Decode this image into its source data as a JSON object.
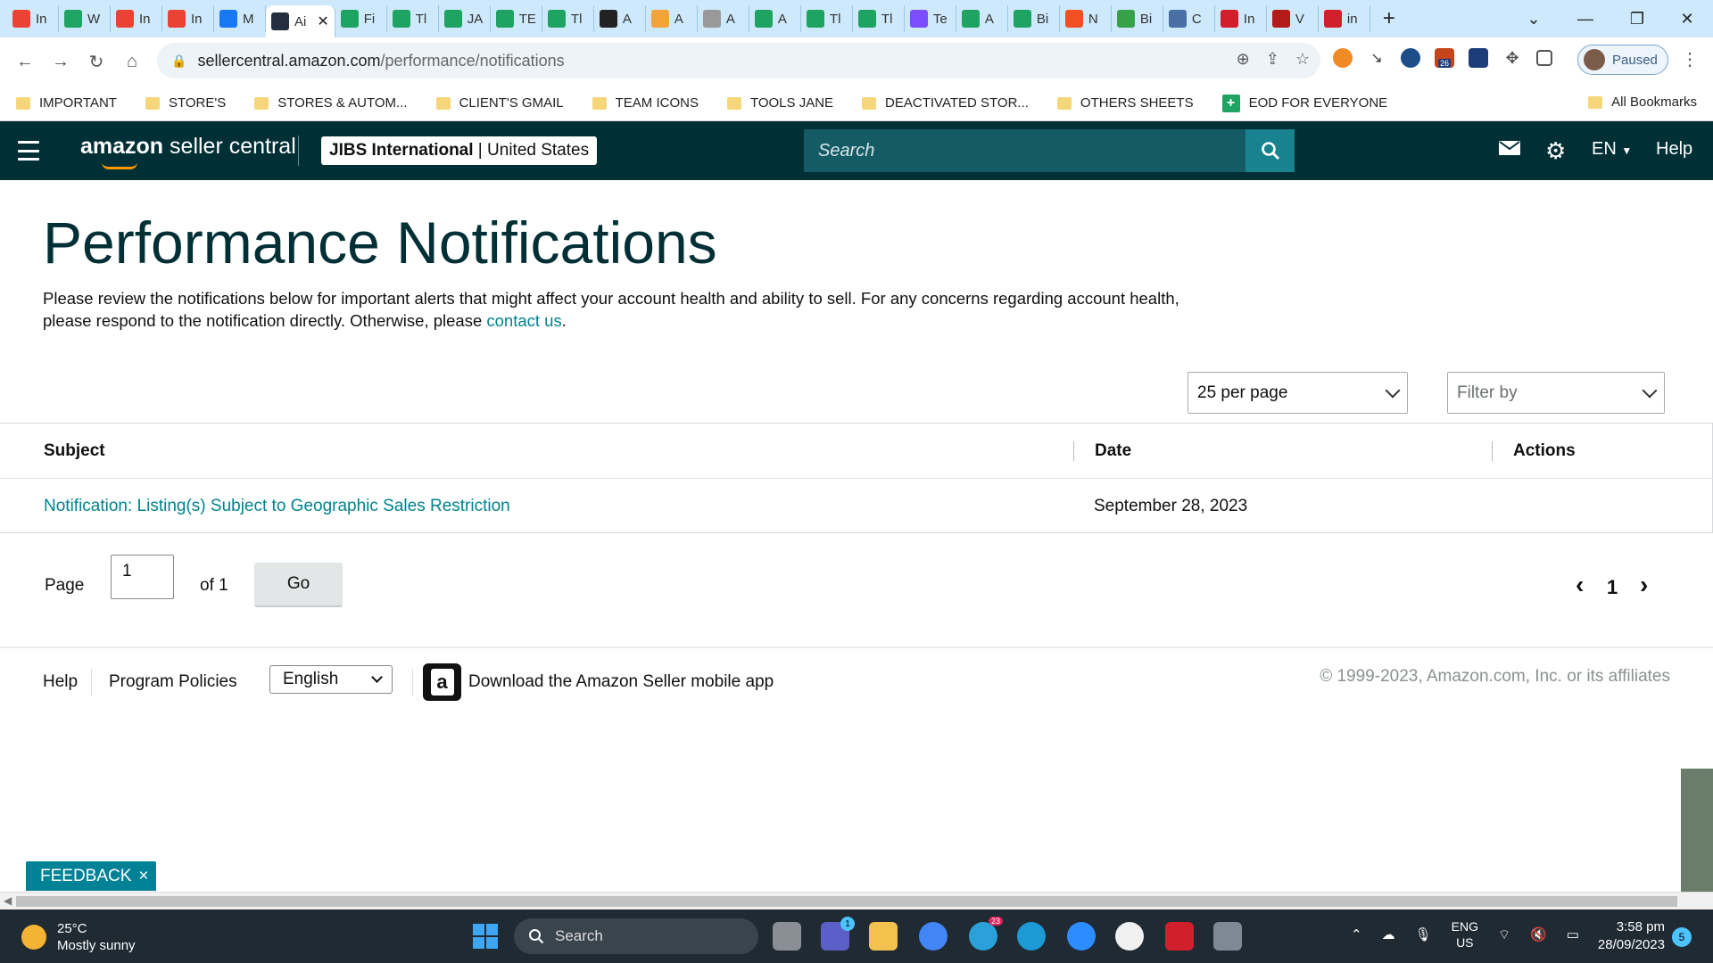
{
  "browser": {
    "tabs": [
      {
        "label": "In",
        "icon": "gmail-icon",
        "color": "#ea4335"
      },
      {
        "label": "W",
        "icon": "drive-icon",
        "color": "#1fa463"
      },
      {
        "label": "In",
        "icon": "gmail-icon",
        "color": "#ea4335"
      },
      {
        "label": "In",
        "icon": "gmail-icon",
        "color": "#ea4335"
      },
      {
        "label": "M",
        "icon": "facebook-icon",
        "color": "#1877f2"
      },
      {
        "label": "Ai",
        "icon": "amazon-icon",
        "color": "#232f3e",
        "active": true
      },
      {
        "label": "Fi",
        "icon": "sheets-icon",
        "color": "#1ea362"
      },
      {
        "label": "Tl",
        "icon": "sheets-icon",
        "color": "#1ea362"
      },
      {
        "label": "JA",
        "icon": "sheets-icon",
        "color": "#1ea362"
      },
      {
        "label": "TE",
        "icon": "sheets-icon",
        "color": "#1ea362"
      },
      {
        "label": "Tl",
        "icon": "sheets-icon",
        "color": "#1ea362"
      },
      {
        "label": "A",
        "icon": "circle-icon",
        "color": "#222"
      },
      {
        "label": "A",
        "icon": "pen-icon",
        "color": "#f2a33a"
      },
      {
        "label": "A",
        "icon": "globe-icon",
        "color": "#999"
      },
      {
        "label": "A",
        "icon": "sheets-icon",
        "color": "#1ea362"
      },
      {
        "label": "Tl",
        "icon": "sheets-icon",
        "color": "#1ea362"
      },
      {
        "label": "Tl",
        "icon": "sheets-icon",
        "color": "#1ea362"
      },
      {
        "label": "Te",
        "icon": "chat-icon",
        "color": "#7b4dff"
      },
      {
        "label": "A",
        "icon": "sheets-icon",
        "color": "#1ea362"
      },
      {
        "label": "Bi",
        "icon": "sheets-icon",
        "color": "#1ea362"
      },
      {
        "label": "N",
        "icon": "windows-icon",
        "color": "#f25022"
      },
      {
        "label": "Bi",
        "icon": "w-icon",
        "color": "#36a148"
      },
      {
        "label": "C",
        "icon": "hat-icon",
        "color": "#4a6fa5"
      },
      {
        "label": "In",
        "icon": "red-icon",
        "color": "#d21f2c"
      },
      {
        "label": "V",
        "icon": "w-red-icon",
        "color": "#b31b1b"
      },
      {
        "label": "in",
        "icon": "v-icon",
        "color": "#d21f2c"
      }
    ],
    "url_host": "sellercentral.amazon.com",
    "url_path": "/performance/notifications",
    "profile_label": "Paused",
    "extension_badge": "26",
    "bookmarks": [
      {
        "label": "IMPORTANT",
        "type": "folder"
      },
      {
        "label": "STORE'S",
        "type": "folder"
      },
      {
        "label": "STORES & AUTOM...",
        "type": "folder"
      },
      {
        "label": "CLIENT'S GMAIL",
        "type": "folder"
      },
      {
        "label": "TEAM ICONS",
        "type": "folder"
      },
      {
        "label": "TOOLS JANE",
        "type": "folder"
      },
      {
        "label": "DEACTIVATED STOR...",
        "type": "folder"
      },
      {
        "label": "OTHERS SHEETS",
        "type": "folder"
      },
      {
        "label": "EOD FOR EVERYONE",
        "type": "sheet"
      }
    ],
    "all_bookmarks": "All Bookmarks"
  },
  "header": {
    "logo_bold": "amazon",
    "logo_rest": " seller central",
    "account_name": "JIBS International",
    "account_sep": " | ",
    "account_region": "United States",
    "search_placeholder": "Search",
    "lang": "EN",
    "help": "Help"
  },
  "main": {
    "title": "Performance Notifications",
    "intro_text": "Please review the notifications below for important alerts that might affect your account health and ability to sell. For any concerns regarding account health, please respond to the notification directly. Otherwise, please ",
    "intro_link": "contact us",
    "intro_end": ".",
    "per_page": "25 per page",
    "filter_by": "Filter by",
    "columns": [
      "Subject",
      "Date",
      "Actions"
    ],
    "rows": [
      {
        "subject": "Notification: Listing(s) Subject to Geographic Sales Restriction",
        "date": "September 28, 2023",
        "actions": ""
      }
    ],
    "pager": {
      "page_label": "Page",
      "page_value": "1",
      "of_label": "of 1",
      "go": "Go",
      "current": "1",
      "prev": "‹",
      "next": "›"
    }
  },
  "footer": {
    "help": "Help",
    "policies": "Program Policies",
    "language": "English",
    "app_text": "Download the Amazon Seller mobile app",
    "copyright": "© 1999-2023, Amazon.com, Inc. or its affiliates"
  },
  "feedback": {
    "label": "FEEDBACK",
    "close": "×"
  },
  "taskbar": {
    "temp": "25°C",
    "weather": "Mostly sunny",
    "search": "Search",
    "lang_top": "ENG",
    "lang_bottom": "US",
    "time": "3:58 pm",
    "date": "28/09/2023",
    "notifications": "5",
    "teams_badge": "1",
    "telegram_badge": "23"
  }
}
